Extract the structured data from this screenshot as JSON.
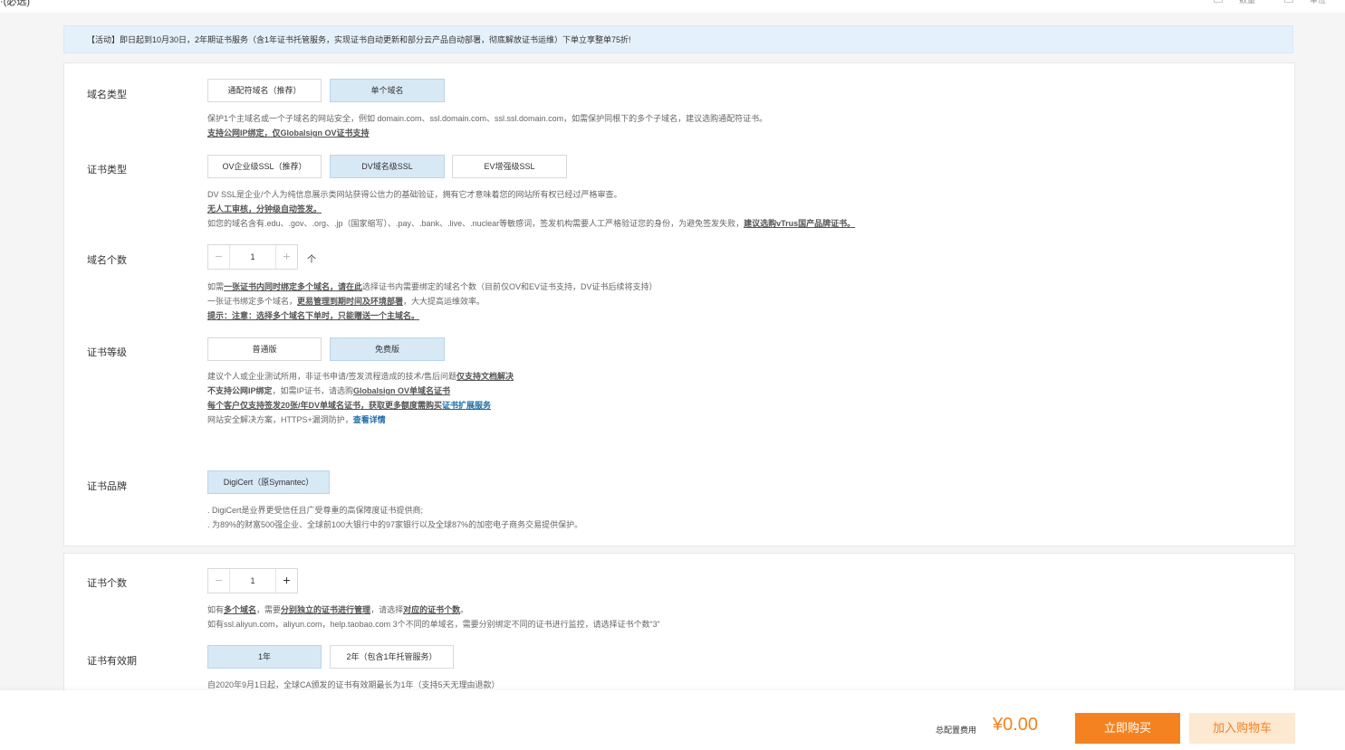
{
  "topbar": {
    "fragment": "·(必选)",
    "right_label_1": "数量",
    "right_label_2": "单位"
  },
  "notice": "【活动】即日起到10月30日，2年期证书服务（含1年证书托管服务，实现证书自动更新和部分云产品自动部署，彻底解放证书运维）下单立享整单75折!",
  "domain_type": {
    "label": "域名类型",
    "options": [
      "通配符域名（推荐）",
      "单个域名"
    ],
    "selected": "单个域名",
    "desc1": "保护1个主域名或一个子域名的网站安全，例如 domain.com、ssl.domain.com、ssl.ssl.domain.com，如需保护同根下的多个子域名，建议选购通配符证书。",
    "desc2": "支持公网IP绑定，仅Globalsign OV证书支持"
  },
  "cert_type": {
    "label": "证书类型",
    "options": [
      "OV企业级SSL（推荐）",
      "DV域名级SSL",
      "EV增强级SSL"
    ],
    "selected": "DV域名级SSL",
    "desc1": "DV SSL是企业/个人为纯信息展示类网站获得公信力的基础验证，拥有它才意味着您的网站所有权已经过严格审查。",
    "desc2": "无人工审核，分钟级自动签发。",
    "desc3": "如您的域名含有.edu、.gov、.org、.jp（国家缩写）、.pay、.bank、.live、.nuclear等敏感词，签发机构需要人工严格验证您的身份，为避免签发失败，",
    "desc3_link": "建议选购vTrus国产品牌证书。"
  },
  "domain_count": {
    "label": "域名个数",
    "value": "1",
    "unit": "个",
    "desc1_pre": "如需",
    "desc1_bold": "一张证书内同时绑定多个域名，请在此",
    "desc1_post": "选择证书内需要绑定的域名个数（目前仅OV和EV证书支持，DV证书后续将支持）",
    "desc2_pre": "一张证书绑定多个域名，",
    "desc2_bold": "更易管理到期时间及环境部署",
    "desc2_post": "，大大提高运维效率。",
    "desc3": "提示：注意：选择多个域名下单时，只能赠送一个主域名。"
  },
  "cert_level": {
    "label": "证书等级",
    "options": [
      "普通版",
      "免费版"
    ],
    "selected": "免费版",
    "desc1_pre": "建议个人或企业测试所用，非证书申请/签发流程造成的技术/售后问题",
    "desc1_bold": "仅支持文档解决",
    "desc2_bold": "不支持公网IP绑定",
    "desc2_mid": "，如需IP证书，请选购",
    "desc2_link": "Globalsign OV单域名证书",
    "desc3_bold": "每个客户仅支持签发20张/年DV单域名证书，获取更多额度需购买",
    "desc3_link": "证书扩展服务",
    "desc4_pre": "网站安全解决方案，HTTPS+漏洞防护，",
    "desc4_link": "查看详情"
  },
  "cert_brand": {
    "label": "证书品牌",
    "option": "DigiCert（原Symantec）",
    "desc1": ". DigiCert是业界更受信任且广受尊重的高保障度证书提供商;",
    "desc2": ". 为89%的财富500强企业、全球前100大银行中的97家银行以及全球87%的加密电子商务交易提供保护。"
  },
  "cert_count": {
    "label": "证书个数",
    "value": "1",
    "desc1_pre": "如有",
    "desc1_b1": "多个域名",
    "desc1_mid": "，需要",
    "desc1_b2": "分别独立的证书进行管理",
    "desc1_mid2": "，请选择",
    "desc1_b3": "对应的证书个数",
    "desc1_end": "。",
    "desc2": "如有ssl.aliyun.com，aliyun.com，help.taobao.com 3个不同的单域名，需要分别绑定不同的证书进行监控，请选择证书个数“3”"
  },
  "validity": {
    "label": "证书有效期",
    "options": [
      "1年",
      "2年（包含1年托管服务）"
    ],
    "selected": "1年",
    "desc1": "自2020年9月1日起，全球CA颁发的证书有效期最长为1年（支持5天无理由退款）"
  },
  "footer": {
    "total_label": "总配置费用",
    "price": "¥0.00",
    "buy_label": "立即购买",
    "cart_label": "加入购物车"
  },
  "colors": {
    "accent": "#f58220",
    "selected_bg": "#d8e9f6",
    "notice_bg": "#e5f1fa",
    "link": "#1c6ca8"
  }
}
